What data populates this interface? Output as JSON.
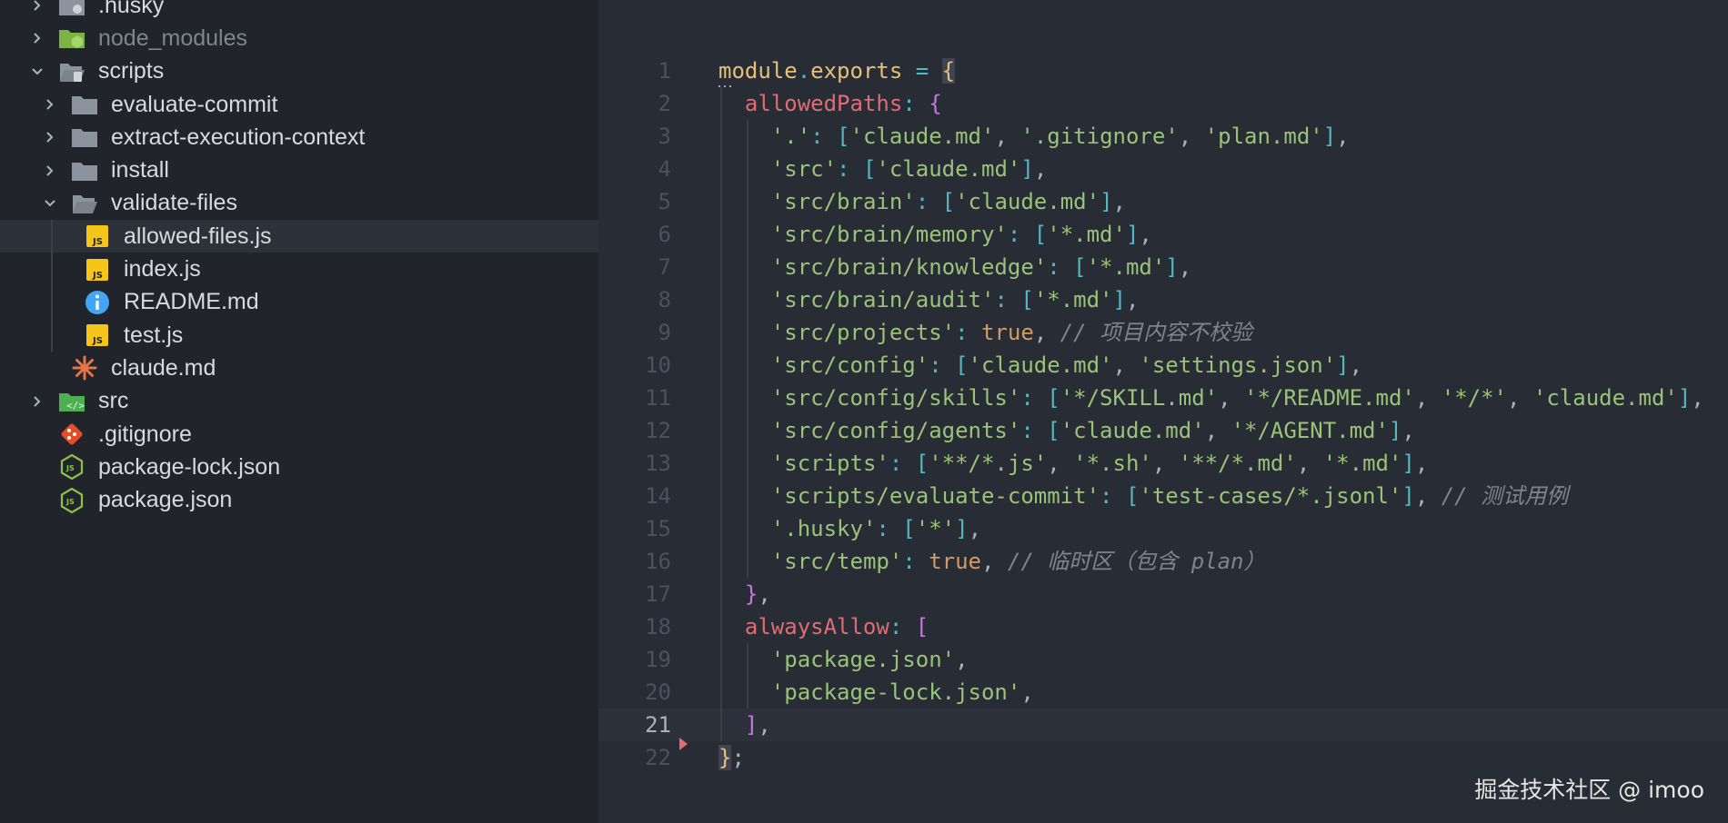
{
  "sidebar": {
    "items": [
      {
        "label": ".husky",
        "depth": 1,
        "kind": "folder-husky",
        "chevron": "right"
      },
      {
        "label": "node_modules",
        "depth": 1,
        "kind": "folder-node",
        "chevron": "right",
        "dim": true
      },
      {
        "label": "scripts",
        "depth": 1,
        "kind": "folder-scripts",
        "chevron": "down"
      },
      {
        "label": "evaluate-commit",
        "depth": 2,
        "kind": "folder",
        "chevron": "right"
      },
      {
        "label": "extract-execution-context",
        "depth": 2,
        "kind": "folder",
        "chevron": "right"
      },
      {
        "label": "install",
        "depth": 2,
        "kind": "folder",
        "chevron": "right"
      },
      {
        "label": "validate-files",
        "depth": 2,
        "kind": "folder-open",
        "chevron": "down"
      },
      {
        "label": "allowed-files.js",
        "depth": 3,
        "kind": "js",
        "selected": true
      },
      {
        "label": "index.js",
        "depth": 3,
        "kind": "js"
      },
      {
        "label": "README.md",
        "depth": 3,
        "kind": "info"
      },
      {
        "label": "test.js",
        "depth": 3,
        "kind": "js"
      },
      {
        "label": "claude.md",
        "depth": 2,
        "kind": "claude"
      },
      {
        "label": "src",
        "depth": 1,
        "kind": "folder-src",
        "chevron": "right"
      },
      {
        "label": ".gitignore",
        "depth": 1,
        "kind": "git"
      },
      {
        "label": "package-lock.json",
        "depth": 1,
        "kind": "nodejs"
      },
      {
        "label": "package.json",
        "depth": 1,
        "kind": "nodejs"
      }
    ]
  },
  "editor": {
    "current_line": 21,
    "lines": [
      {
        "n": "1",
        "indent": 0,
        "tokens": [
          [
            "k",
            "module"
          ],
          [
            "o",
            "."
          ],
          [
            "k",
            "exports"
          ],
          [
            "t",
            " "
          ],
          [
            "o",
            "="
          ],
          [
            "t",
            " "
          ],
          [
            "br1 match",
            "{"
          ]
        ]
      },
      {
        "n": "2",
        "indent": 1,
        "tokens": [
          [
            "p",
            "allowedPaths"
          ],
          [
            "o",
            ":"
          ],
          [
            "t",
            " "
          ],
          [
            "br2",
            "{"
          ]
        ]
      },
      {
        "n": "3",
        "indent": 2,
        "tokens": [
          [
            "s",
            "'.'"
          ],
          [
            "o",
            ":"
          ],
          [
            "t",
            " "
          ],
          [
            "br3",
            "["
          ],
          [
            "s",
            "'claude.md'"
          ],
          [
            "t",
            ", "
          ],
          [
            "s",
            "'.gitignore'"
          ],
          [
            "t",
            ", "
          ],
          [
            "s",
            "'plan.md'"
          ],
          [
            "br3",
            "]"
          ],
          [
            "t",
            ","
          ]
        ]
      },
      {
        "n": "4",
        "indent": 2,
        "tokens": [
          [
            "s",
            "'src'"
          ],
          [
            "o",
            ":"
          ],
          [
            "t",
            " "
          ],
          [
            "br3",
            "["
          ],
          [
            "s",
            "'claude.md'"
          ],
          [
            "br3",
            "]"
          ],
          [
            "t",
            ","
          ]
        ]
      },
      {
        "n": "5",
        "indent": 2,
        "tokens": [
          [
            "s",
            "'src/brain'"
          ],
          [
            "o",
            ":"
          ],
          [
            "t",
            " "
          ],
          [
            "br3",
            "["
          ],
          [
            "s",
            "'claude.md'"
          ],
          [
            "br3",
            "]"
          ],
          [
            "t",
            ","
          ]
        ]
      },
      {
        "n": "6",
        "indent": 2,
        "tokens": [
          [
            "s",
            "'src/brain/memory'"
          ],
          [
            "o",
            ":"
          ],
          [
            "t",
            " "
          ],
          [
            "br3",
            "["
          ],
          [
            "s",
            "'*.md'"
          ],
          [
            "br3",
            "]"
          ],
          [
            "t",
            ","
          ]
        ]
      },
      {
        "n": "7",
        "indent": 2,
        "tokens": [
          [
            "s",
            "'src/brain/knowledge'"
          ],
          [
            "o",
            ":"
          ],
          [
            "t",
            " "
          ],
          [
            "br3",
            "["
          ],
          [
            "s",
            "'*.md'"
          ],
          [
            "br3",
            "]"
          ],
          [
            "t",
            ","
          ]
        ]
      },
      {
        "n": "8",
        "indent": 2,
        "tokens": [
          [
            "s",
            "'src/brain/audit'"
          ],
          [
            "o",
            ":"
          ],
          [
            "t",
            " "
          ],
          [
            "br3",
            "["
          ],
          [
            "s",
            "'*.md'"
          ],
          [
            "br3",
            "]"
          ],
          [
            "t",
            ","
          ]
        ]
      },
      {
        "n": "9",
        "indent": 2,
        "tokens": [
          [
            "s",
            "'src/projects'"
          ],
          [
            "o",
            ":"
          ],
          [
            "t",
            " "
          ],
          [
            "b",
            "true"
          ],
          [
            "t",
            ", "
          ],
          [
            "c",
            "// 项目内容不校验"
          ]
        ]
      },
      {
        "n": "10",
        "indent": 2,
        "tokens": [
          [
            "s",
            "'src/config'"
          ],
          [
            "o",
            ":"
          ],
          [
            "t",
            " "
          ],
          [
            "br3",
            "["
          ],
          [
            "s",
            "'claude.md'"
          ],
          [
            "t",
            ", "
          ],
          [
            "s",
            "'settings.json'"
          ],
          [
            "br3",
            "]"
          ],
          [
            "t",
            ","
          ]
        ]
      },
      {
        "n": "11",
        "indent": 2,
        "tokens": [
          [
            "s",
            "'src/config/skills'"
          ],
          [
            "o",
            ":"
          ],
          [
            "t",
            " "
          ],
          [
            "br3",
            "["
          ],
          [
            "s",
            "'*/SKILL.md'"
          ],
          [
            "t",
            ", "
          ],
          [
            "s",
            "'*/README.md'"
          ],
          [
            "t",
            ", "
          ],
          [
            "s",
            "'*/*'"
          ],
          [
            "t",
            ", "
          ],
          [
            "s",
            "'claude.md'"
          ],
          [
            "br3",
            "]"
          ],
          [
            "t",
            ","
          ]
        ]
      },
      {
        "n": "12",
        "indent": 2,
        "tokens": [
          [
            "s",
            "'src/config/agents'"
          ],
          [
            "o",
            ":"
          ],
          [
            "t",
            " "
          ],
          [
            "br3",
            "["
          ],
          [
            "s",
            "'claude.md'"
          ],
          [
            "t",
            ", "
          ],
          [
            "s",
            "'*/AGENT.md'"
          ],
          [
            "br3",
            "]"
          ],
          [
            "t",
            ","
          ]
        ]
      },
      {
        "n": "13",
        "indent": 2,
        "tokens": [
          [
            "s",
            "'scripts'"
          ],
          [
            "o",
            ":"
          ],
          [
            "t",
            " "
          ],
          [
            "br3",
            "["
          ],
          [
            "s",
            "'**/*.js'"
          ],
          [
            "t",
            ", "
          ],
          [
            "s",
            "'*.sh'"
          ],
          [
            "t",
            ", "
          ],
          [
            "s",
            "'**/*.md'"
          ],
          [
            "t",
            ", "
          ],
          [
            "s",
            "'*.md'"
          ],
          [
            "br3",
            "]"
          ],
          [
            "t",
            ","
          ]
        ]
      },
      {
        "n": "14",
        "indent": 2,
        "tokens": [
          [
            "s",
            "'scripts/evaluate-commit'"
          ],
          [
            "o",
            ":"
          ],
          [
            "t",
            " "
          ],
          [
            "br3",
            "["
          ],
          [
            "s",
            "'test-cases/*.jsonl'"
          ],
          [
            "br3",
            "]"
          ],
          [
            "t",
            ", "
          ],
          [
            "c",
            "// 测试用例"
          ]
        ]
      },
      {
        "n": "15",
        "indent": 2,
        "tokens": [
          [
            "s",
            "'.husky'"
          ],
          [
            "o",
            ":"
          ],
          [
            "t",
            " "
          ],
          [
            "br3",
            "["
          ],
          [
            "s",
            "'*'"
          ],
          [
            "br3",
            "]"
          ],
          [
            "t",
            ","
          ]
        ]
      },
      {
        "n": "16",
        "indent": 2,
        "tokens": [
          [
            "s",
            "'src/temp'"
          ],
          [
            "o",
            ":"
          ],
          [
            "t",
            " "
          ],
          [
            "b",
            "true"
          ],
          [
            "t",
            ", "
          ],
          [
            "c",
            "// 临时区（包含 plan）"
          ]
        ]
      },
      {
        "n": "17",
        "indent": 1,
        "tokens": [
          [
            "br2",
            "}"
          ],
          [
            "t",
            ","
          ]
        ]
      },
      {
        "n": "18",
        "indent": 1,
        "tokens": [
          [
            "p",
            "alwaysAllow"
          ],
          [
            "o",
            ":"
          ],
          [
            "t",
            " "
          ],
          [
            "br2",
            "["
          ]
        ]
      },
      {
        "n": "19",
        "indent": 2,
        "tokens": [
          [
            "s",
            "'package.json'"
          ],
          [
            "t",
            ","
          ]
        ]
      },
      {
        "n": "20",
        "indent": 2,
        "tokens": [
          [
            "s",
            "'package-lock.json'"
          ],
          [
            "t",
            ","
          ]
        ]
      },
      {
        "n": "21",
        "indent": 1,
        "tokens": [
          [
            "br2",
            "]"
          ],
          [
            "t",
            ","
          ]
        ]
      },
      {
        "n": "22",
        "indent": 0,
        "tokens": [
          [
            "br1 match",
            "}"
          ],
          [
            "t",
            ";"
          ]
        ]
      }
    ]
  },
  "watermark": "掘金技术社区 @ imoo",
  "colors": {
    "sidebar_bg": "#21252b",
    "editor_bg": "#282c34",
    "selected_row": "#2c313a",
    "string": "#98c379",
    "key": "#e06c75"
  }
}
